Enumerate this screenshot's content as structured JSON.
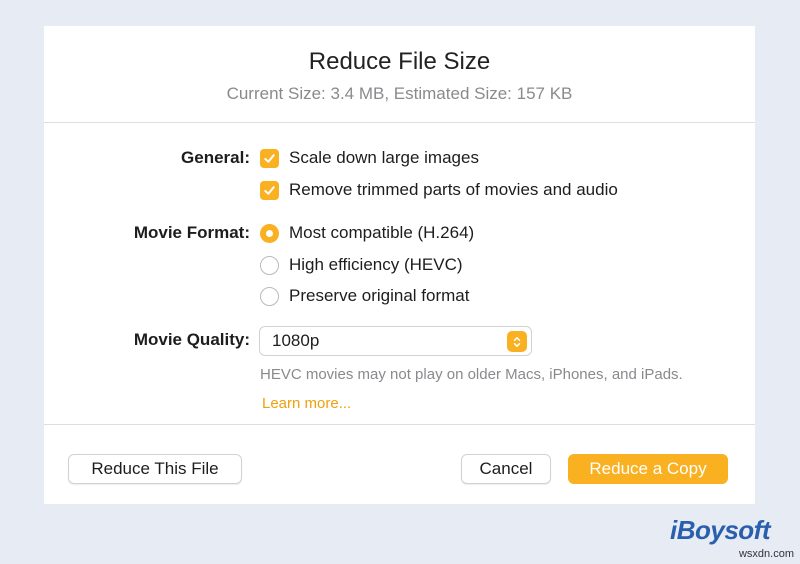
{
  "dialog": {
    "title": "Reduce File Size",
    "subtitle": "Current Size: 3.4 MB, Estimated Size: 157 KB"
  },
  "general": {
    "label": "General:",
    "options": [
      {
        "label": "Scale down large images",
        "checked": true
      },
      {
        "label": "Remove trimmed parts of movies and audio",
        "checked": true
      }
    ]
  },
  "movie_format": {
    "label": "Movie Format:",
    "options": [
      {
        "label": "Most compatible (H.264)",
        "selected": true
      },
      {
        "label": "High efficiency (HEVC)",
        "selected": false
      },
      {
        "label": "Preserve original format",
        "selected": false
      }
    ]
  },
  "movie_quality": {
    "label": "Movie Quality:",
    "value": "1080p",
    "hint": "HEVC movies may not play on older Macs, iPhones, and iPads.",
    "learn_more": "Learn more..."
  },
  "buttons": {
    "reduce_this_file": "Reduce This File",
    "cancel": "Cancel",
    "reduce_copy": "Reduce a Copy"
  },
  "watermark": {
    "logo": "iBoysoft",
    "url": "wsxdn.com"
  },
  "colors": {
    "accent": "#f9b021",
    "link": "#f0a00c",
    "background": "#e7ebf3"
  }
}
